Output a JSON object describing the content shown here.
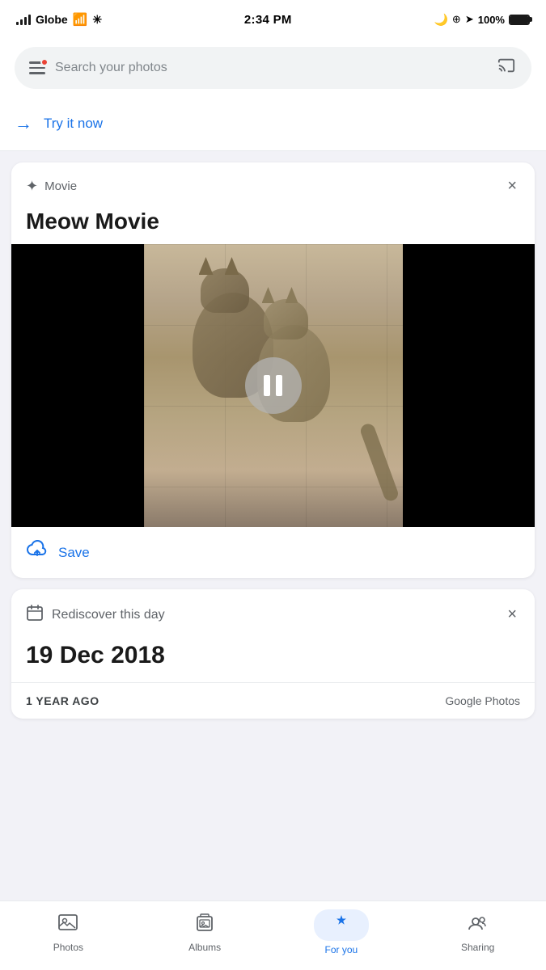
{
  "statusBar": {
    "carrier": "Globe",
    "time": "2:34 PM",
    "battery": "100%"
  },
  "searchBar": {
    "placeholder": "Search your photos"
  },
  "tryItNow": {
    "label": "Try it now"
  },
  "movieCard": {
    "sectionLabel": "Movie",
    "title": "Meow Movie",
    "saveLabel": "Save",
    "closeLabel": "×"
  },
  "rediscoverCard": {
    "sectionLabel": "Rediscover this day",
    "dateTitle": "19 Dec 2018",
    "yearAgo": "1 YEAR AGO",
    "brandLabel": "Google Photos",
    "closeLabel": "×"
  },
  "bottomNav": {
    "items": [
      {
        "id": "photos",
        "label": "Photos",
        "active": false
      },
      {
        "id": "albums",
        "label": "Albums",
        "active": false
      },
      {
        "id": "for-you",
        "label": "For you",
        "active": true
      },
      {
        "id": "sharing",
        "label": "Sharing",
        "active": false
      }
    ]
  }
}
